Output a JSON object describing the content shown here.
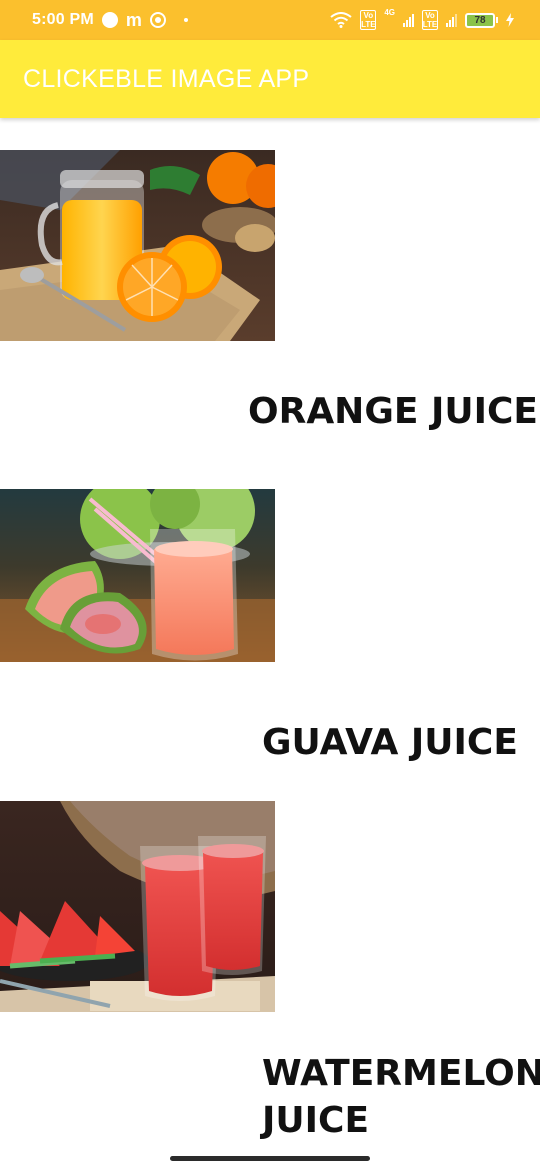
{
  "status_bar": {
    "time": "5:00 PM",
    "battery_level": "78",
    "network": "4G",
    "volte_label": "Vo LTE"
  },
  "app_bar": {
    "title": "CLICKEBLE IMAGE APP"
  },
  "items": [
    {
      "label": "ORANGE JUICE",
      "image_subject": "orange juice in a glass jar with sliced oranges"
    },
    {
      "label": "GUAVA JUICE",
      "image_subject": "guava juice glass with halved guavas"
    },
    {
      "label": "WATERMELON JUICE",
      "label_line1": "WATERMELON",
      "label_line2": "JUICE",
      "image_subject": "two glasses of watermelon juice with watermelon slices"
    }
  ],
  "colors": {
    "status_bar": "#fbc02d",
    "app_bar": "#ffeb3b",
    "title_text": "#ffffff",
    "label_text": "#111111"
  }
}
